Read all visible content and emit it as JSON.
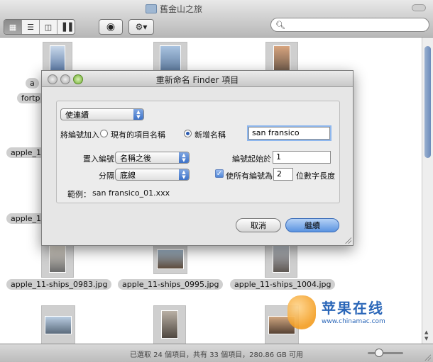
{
  "window": {
    "title": "舊金山之旅"
  },
  "toolbar": {
    "view_buttons": [
      "icon-view",
      "list-view",
      "column-view",
      "coverflow-view"
    ],
    "search_placeholder": ""
  },
  "files": {
    "row1_partial": [
      "a",
      "fortp"
    ],
    "row2_partial": "apple_1",
    "row3_partial": "apple_1",
    "row4": [
      "apple_11-ships_0983.jpg",
      "apple_11-ships_0995.jpg",
      "apple_11-ships_1004.jpg"
    ]
  },
  "dialog": {
    "title": "重新命名 Finder 項目",
    "mode_popup": "使連續",
    "add_label": "將編號加入",
    "radio_existing": "現有的項目名稱",
    "radio_new": "新增名稱",
    "new_name_value": "san fransico",
    "position_label": "置入編號",
    "position_popup": "名稱之後",
    "separator_label": "分隔",
    "separator_popup": "底線",
    "start_label": "編號起始於",
    "start_value": "1",
    "digits_check_label": "使所有編號為",
    "digits_value": "2",
    "digits_suffix": "位數字長度",
    "example_label": "範例：",
    "example_value": "san fransico_01.xxx",
    "cancel_label": "取消",
    "continue_label": "繼續"
  },
  "status": {
    "text": "已選取 24 個項目，共有 33 個項目，280.86 GB 可用"
  },
  "watermark": {
    "name": "苹果在线",
    "url": "www.chinamac.com"
  }
}
